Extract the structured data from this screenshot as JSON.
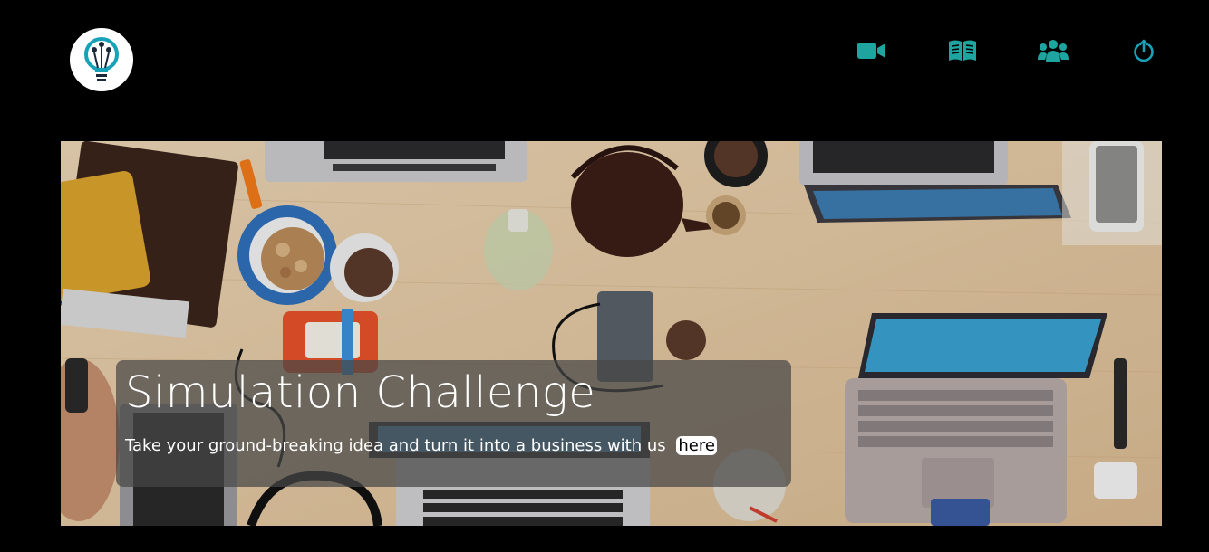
{
  "header": {
    "nav": [
      {
        "name": "video-icon"
      },
      {
        "name": "book-icon"
      },
      {
        "name": "users-icon"
      },
      {
        "name": "power-icon"
      }
    ]
  },
  "hero": {
    "title": "Simulation Challenge",
    "text": "Take your ground-breaking idea and turn it into a business with us",
    "link_label": "here"
  },
  "colors": {
    "accent": "#17a2b8",
    "nav_icon": "#1fa5a0",
    "background": "#000000"
  }
}
